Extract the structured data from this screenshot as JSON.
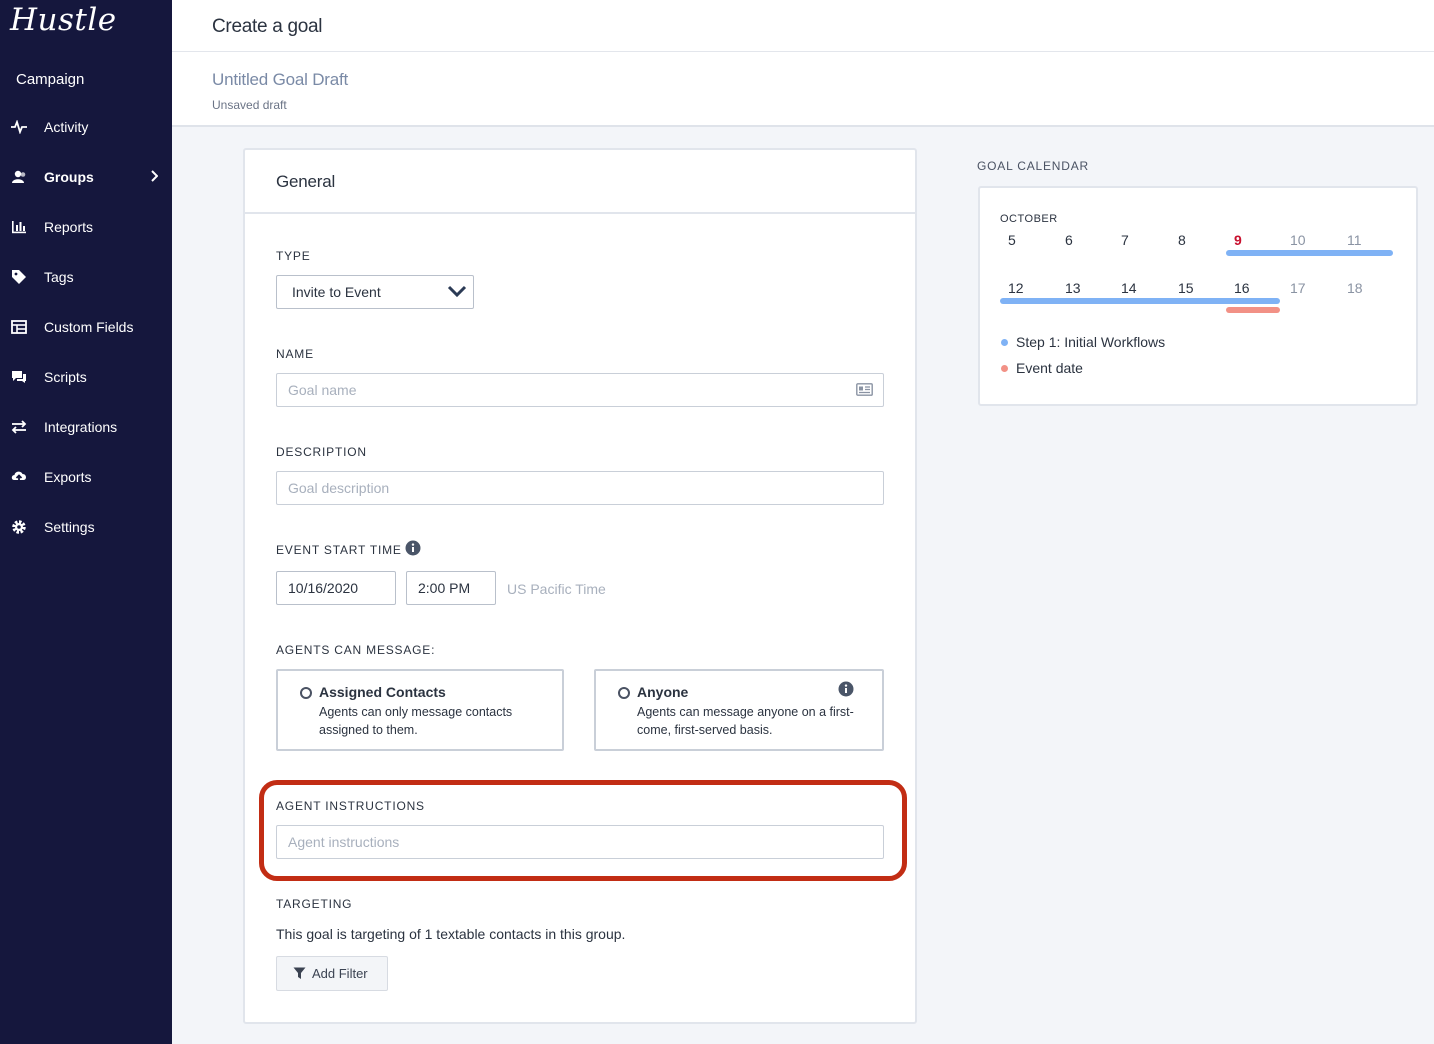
{
  "app": {
    "logo": "Hustle",
    "section": "Campaign"
  },
  "sidebar": {
    "items": [
      {
        "label": "Activity",
        "icon": "activity-icon"
      },
      {
        "label": "Groups",
        "icon": "groups-icon",
        "active": true
      },
      {
        "label": "Reports",
        "icon": "reports-icon"
      },
      {
        "label": "Tags",
        "icon": "tag-icon"
      },
      {
        "label": "Custom Fields",
        "icon": "custom-fields-icon"
      },
      {
        "label": "Scripts",
        "icon": "scripts-icon"
      },
      {
        "label": "Integrations",
        "icon": "integrations-icon"
      },
      {
        "label": "Exports",
        "icon": "exports-icon"
      },
      {
        "label": "Settings",
        "icon": "gear-icon"
      }
    ]
  },
  "header": {
    "title": "Create a goal"
  },
  "draft": {
    "title": "Untitled Goal Draft",
    "status": "Unsaved draft"
  },
  "general": {
    "title": "General",
    "type": {
      "label": "TYPE",
      "value": "Invite to Event"
    },
    "name": {
      "label": "NAME",
      "placeholder": "Goal name"
    },
    "description": {
      "label": "DESCRIPTION",
      "placeholder": "Goal description"
    },
    "event_start": {
      "label": "EVENT START TIME",
      "date": "10/16/2020",
      "time": "2:00 PM",
      "timezone": "US Pacific Time"
    },
    "agents_can_message": {
      "label": "AGENTS CAN MESSAGE:",
      "options": [
        {
          "title": "Assigned Contacts",
          "description": "Agents can only message contacts assigned to them."
        },
        {
          "title": "Anyone",
          "description": "Agents can message anyone on a first-come, first-served basis."
        }
      ]
    },
    "agent_instructions": {
      "label": "AGENT INSTRUCTIONS",
      "placeholder": "Agent instructions"
    },
    "targeting": {
      "label": "TARGETING",
      "text": "This goal is targeting of 1 textable contacts in this group.",
      "add_filter": "Add Filter"
    }
  },
  "calendar": {
    "heading": "GOAL CALENDAR",
    "month": "OCTOBER",
    "week1": [
      "5",
      "6",
      "7",
      "8",
      "9",
      "10",
      "11"
    ],
    "week2": [
      "12",
      "13",
      "14",
      "15",
      "16",
      "17",
      "18"
    ],
    "today": "9",
    "legend": [
      {
        "label": "Step 1: Initial Workflows",
        "color": "#7fb2f5"
      },
      {
        "label": "Event date",
        "color": "#f29186"
      }
    ]
  },
  "colors": {
    "sidebar": "#15173d",
    "highlight": "#c22d14",
    "workflow_bar": "#7fb2f5",
    "event_bar": "#f29186"
  }
}
